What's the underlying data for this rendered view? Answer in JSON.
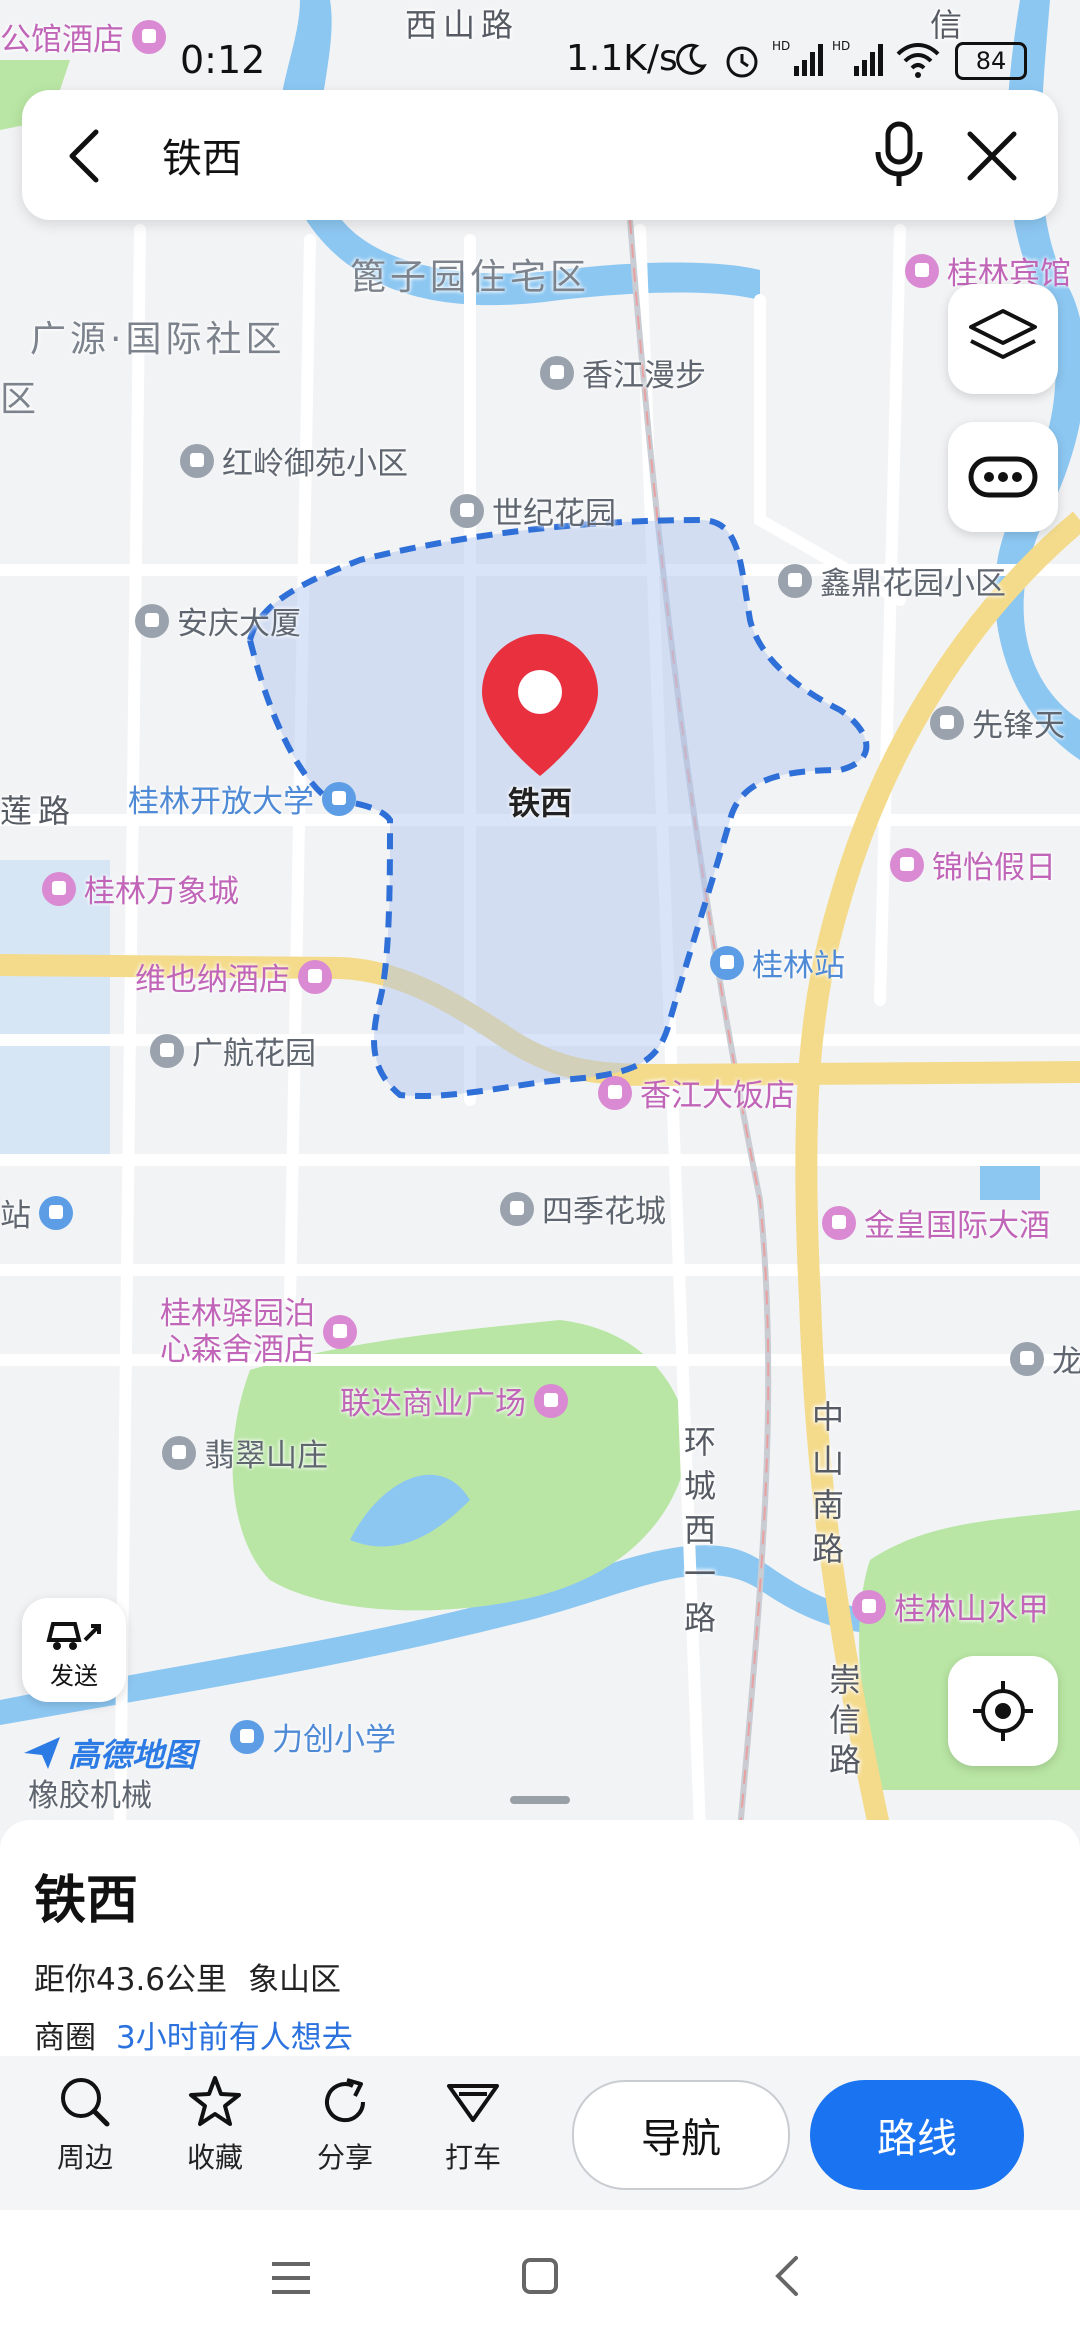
{
  "status": {
    "time": "0:12",
    "net_speed": "1.1K/s",
    "battery": "84"
  },
  "search": {
    "query": "铁西"
  },
  "map": {
    "center_label": "铁西",
    "districts": [
      "篦子园住宅区",
      "广源·国际社区",
      "区"
    ],
    "roads": [
      "西山路",
      "莲路",
      "环城西一路",
      "中山南路",
      "崇信路"
    ],
    "pois": {
      "xiangjiang": "香江漫步",
      "hongling": "红岭御苑小区",
      "shiji": "世纪花园",
      "anqing": "安庆大厦",
      "xinding": "鑫鼎花园小区",
      "xianfeng": "先锋天",
      "open_univ": "桂林开放大学",
      "wanxiang": "桂林万象城",
      "jinyi": "锦怡假日",
      "vienna": "维也纳酒店",
      "guilin_station": "桂林站",
      "guanghang": "广航花园",
      "xj_hotel": "香江大饭店",
      "siji": "四季花城",
      "jinhuang": "金皇国际大酒",
      "yiyuan": "桂林驿园泊\n心森舍酒店",
      "lianda": "联达商业广场",
      "feicui": "翡翠山庄",
      "long": "龙",
      "shanshui": "桂林山水甲",
      "lichuang": "力创小学",
      "xiangjiao": "橡胶机械",
      "guilin_hotel": "桂林宾馆",
      "top_hotel": "公馆酒店",
      "station_left": "站",
      "xin": "信"
    },
    "brand": "高德地图",
    "send_label": "发送"
  },
  "place": {
    "name": "铁西",
    "distance": "距你43.6公里",
    "district": "象山区",
    "category": "商圈",
    "hint": "3小时前有人想去"
  },
  "actions": {
    "nearby": "周边",
    "favorite": "收藏",
    "share": "分享",
    "taxi": "打车",
    "navigate": "导航",
    "route": "路线"
  },
  "colors": {
    "accent": "#1a73f0",
    "boundary": "#2f6fd8",
    "water": "#8cc7f2",
    "park": "#b9e6a4",
    "main_road": "#f4db8c",
    "pin": "#e8303f"
  }
}
